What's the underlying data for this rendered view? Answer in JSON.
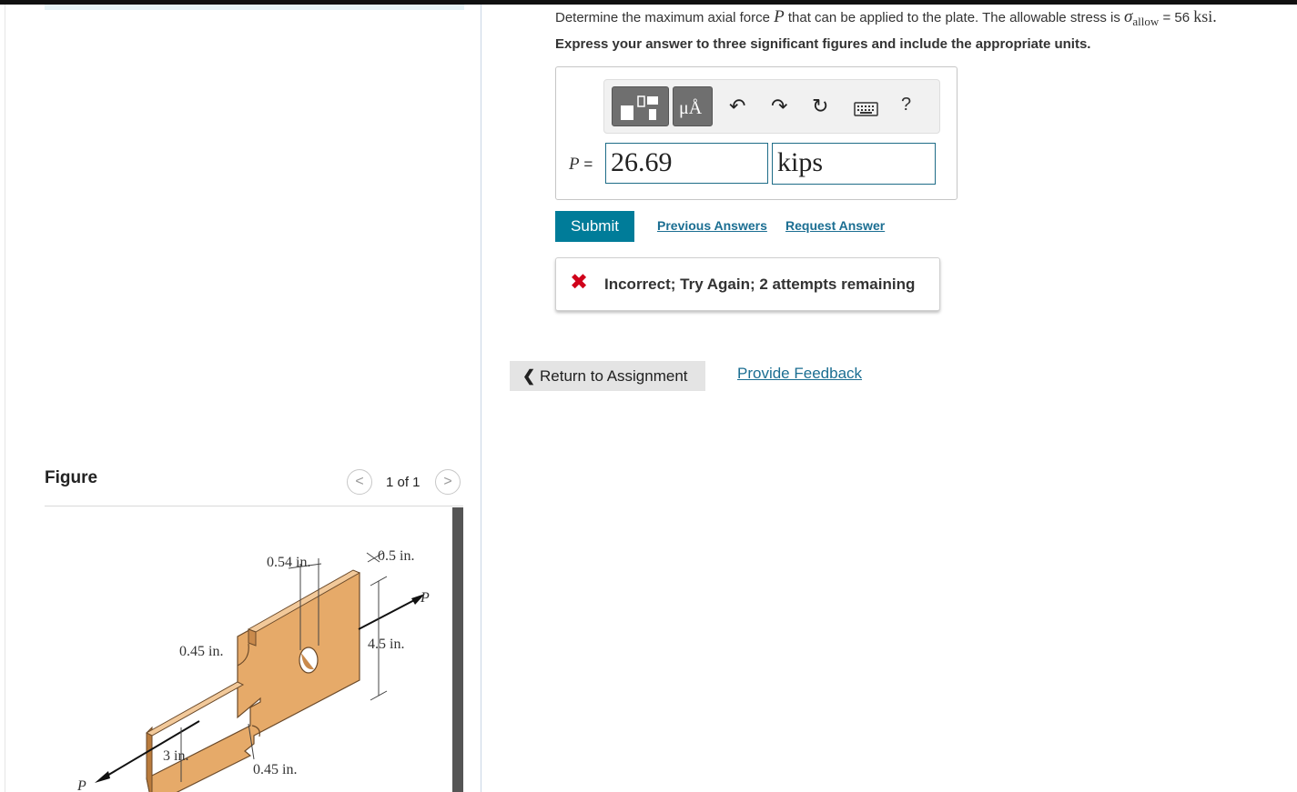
{
  "question": {
    "text_before": "Determine the maximum axial force",
    "var_p": "P",
    "text_middle": "that can be applied to the plate. The allowable stress is",
    "sigma": "σ",
    "sigma_sub": "allow",
    "text_eq": "= 56",
    "unit": "ksi.",
    "instruction": "Express your answer to three significant figures and include the appropriate units."
  },
  "toolbar": {
    "icons": [
      "templates-icon",
      "units-icon",
      "undo-icon",
      "redo-icon",
      "reset-icon",
      "keyboard-icon",
      "help-icon"
    ],
    "units_label": "μÅ",
    "undo": "↶",
    "redo": "↷",
    "reset": "↻",
    "help": "?"
  },
  "answer": {
    "label_var": "P",
    "label_eq": "=",
    "value": "26.69",
    "unit": "kips"
  },
  "actions": {
    "submit": "Submit",
    "previous_answers": "Previous Answers",
    "request_answer": "Request Answer"
  },
  "feedback": {
    "icon": "✖",
    "message": "Incorrect; Try Again; 2 attempts remaining"
  },
  "footer": {
    "return": "Return to Assignment",
    "provide_feedback": "Provide Feedback"
  },
  "figure": {
    "title": "Figure",
    "pager": "1 of 1",
    "labels": {
      "d054": "0.54 in.",
      "d05": "0.5 in.",
      "d045a": "0.45 in.",
      "d45": "4.5 in.",
      "d3": "3 in.",
      "d045b": "0.45 in.",
      "P_left": "P",
      "P_right": "P"
    }
  }
}
